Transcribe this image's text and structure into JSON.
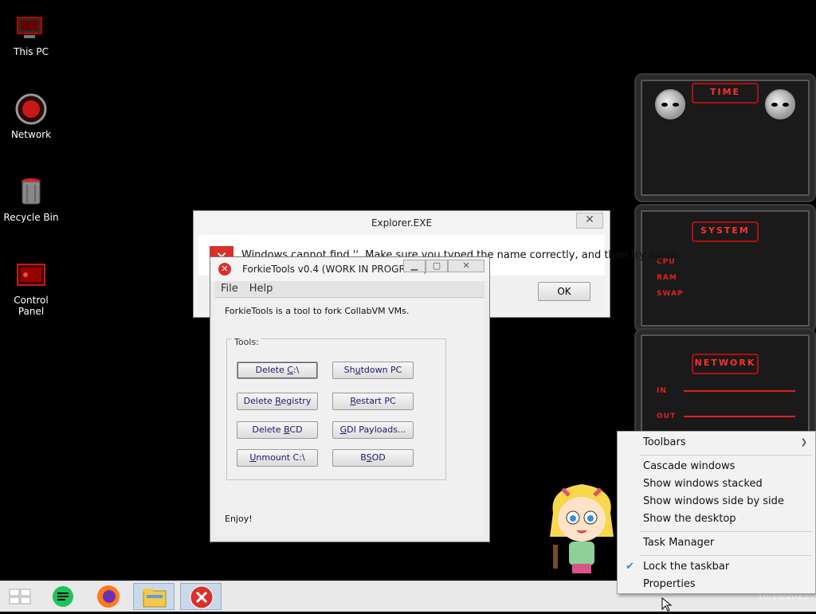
{
  "desktop": {
    "icons": [
      {
        "label": "This PC",
        "icon": "computer-icon"
      },
      {
        "label": "Network",
        "icon": "network-icon"
      },
      {
        "label": "Recycle Bin",
        "icon": "recycle-bin-icon"
      },
      {
        "label": "Control Panel",
        "icon": "control-panel-icon"
      }
    ]
  },
  "explorer_dialog": {
    "title": "Explorer.EXE",
    "message": "Windows cannot find ''. Make sure you typed the name correctly, and then try again.",
    "ok_label": "OK"
  },
  "forkie": {
    "title": "ForkieTools v0.4 (WORK IN PROGRESS)",
    "menu": [
      "File",
      "Help"
    ],
    "description": "ForkieTools is a tool to fork CollabVM VMs.",
    "group_label": "Tools:",
    "buttons": [
      {
        "pre": "Delete ",
        "ul": "C",
        "post": ":\\"
      },
      {
        "pre": "Sh",
        "ul": "u",
        "post": "tdown PC"
      },
      {
        "pre": "Delete ",
        "ul": "R",
        "post": "egistry"
      },
      {
        "pre": "",
        "ul": "R",
        "post": "estart PC"
      },
      {
        "pre": "Delete ",
        "ul": "B",
        "post": "CD"
      },
      {
        "pre": "",
        "ul": "G",
        "post": "DI Payloads..."
      },
      {
        "pre": "",
        "ul": "U",
        "post": "nmount C:\\"
      },
      {
        "pre": "B",
        "ul": "S",
        "post": "OD"
      }
    ],
    "footer": "Enjoy!"
  },
  "gadgets": {
    "time": {
      "title": "TIME"
    },
    "system": {
      "title": "SYSTEM",
      "rows": [
        "CPU",
        "RAM",
        "SWAP"
      ]
    },
    "network": {
      "title": "NETWORK",
      "rows": [
        "IN",
        "OUT"
      ]
    }
  },
  "context_menu": {
    "toolbars": "Toolbars",
    "cascade": "Cascade windows",
    "stacked": "Show windows stacked",
    "side_by_side": "Show windows side by side",
    "show_desktop": "Show the desktop",
    "task_manager": "Task Manager",
    "lock_taskbar": "Lock the taskbar",
    "lock_checked": true,
    "properties": "Properties"
  },
  "taskbar": {
    "items": [
      "start-icon",
      "notes-app-icon",
      "firefox-icon",
      "file-explorer-icon",
      "error-app-icon"
    ],
    "clock": "10/13/2023"
  },
  "colors": {
    "accent_red": "#d9302c",
    "gadget_red": "#e02020",
    "taskbar_bg": "#e9e9e9"
  }
}
